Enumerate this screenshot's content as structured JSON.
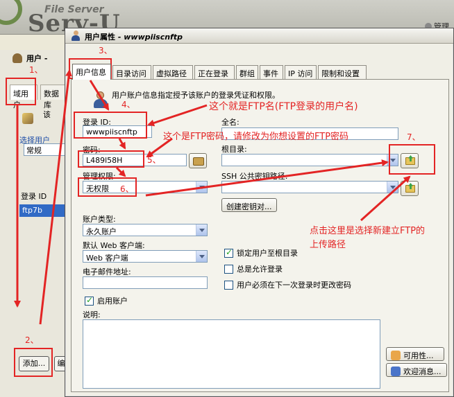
{
  "background": {
    "logo_top": "File Server",
    "logo_main": "Serv-U",
    "right_user_label": "管理",
    "panel_title": "用户 -",
    "tabs": [
      "域用户",
      "数据库"
    ],
    "field_text": "该",
    "group_label": "选择用户",
    "select_value": "常规",
    "list_header": "登录 ID",
    "list_selected": "ftp7b",
    "add_button": "添加...",
    "edit_button": "编"
  },
  "dialog": {
    "title": "用户属性",
    "title_sub": "- wwwpiiscnftp",
    "tabs": [
      "用户信息",
      "目录访问",
      "虚拟路径",
      "正在登录",
      "群组",
      "事件",
      "IP 访问",
      "限制和设置"
    ],
    "description": "用户账户信息指定授予该账户的登录凭证和权限。",
    "login_id_label": "登录 ID:",
    "login_id_value": "wwwpiiscnftp",
    "fullname_label": "全名:",
    "fullname_value": "",
    "password_label": "密码:",
    "password_value": "L489l58H",
    "root_label": "根目录:",
    "root_value": "",
    "admin_label": "管理权限:",
    "admin_value": "无权限",
    "ssh_label": "SSH 公共密钥路径:",
    "ssh_value": "",
    "create_key_button": "创建密钥对...",
    "account_type_label": "账户类型:",
    "account_type_value": "永久账户",
    "web_client_label": "默认 Web 客户端:",
    "web_client_value": "Web 客户端",
    "email_label": "电子邮件地址:",
    "email_value": "",
    "lock_root_label": "锁定用户至根目录",
    "lock_root_checked": true,
    "always_allow_label": "总是允许登录",
    "always_allow_checked": false,
    "change_pw_label": "用户必须在下一次登录时更改密码",
    "change_pw_checked": false,
    "enable_account_label": "启用账户",
    "enable_account_checked": true,
    "notes_label": "说明:",
    "availability_button": "可用性...",
    "welcome_button": "欢迎消息..."
  },
  "annotations": {
    "n1": "1、",
    "n2": "2、",
    "n3": "3、",
    "n4": "4、",
    "n5": "5、",
    "n6": "6、",
    "n7": "7、",
    "ftp_name": "这个就是FTP名(FTP登录的用户名)",
    "ftp_password": "这个是FTP密码，请修改为你想设置的FTP密码",
    "upload_path_line1": "点击这里是选择新建立FTP的",
    "upload_path_line2": "上传路径",
    "color": "#e32424"
  }
}
